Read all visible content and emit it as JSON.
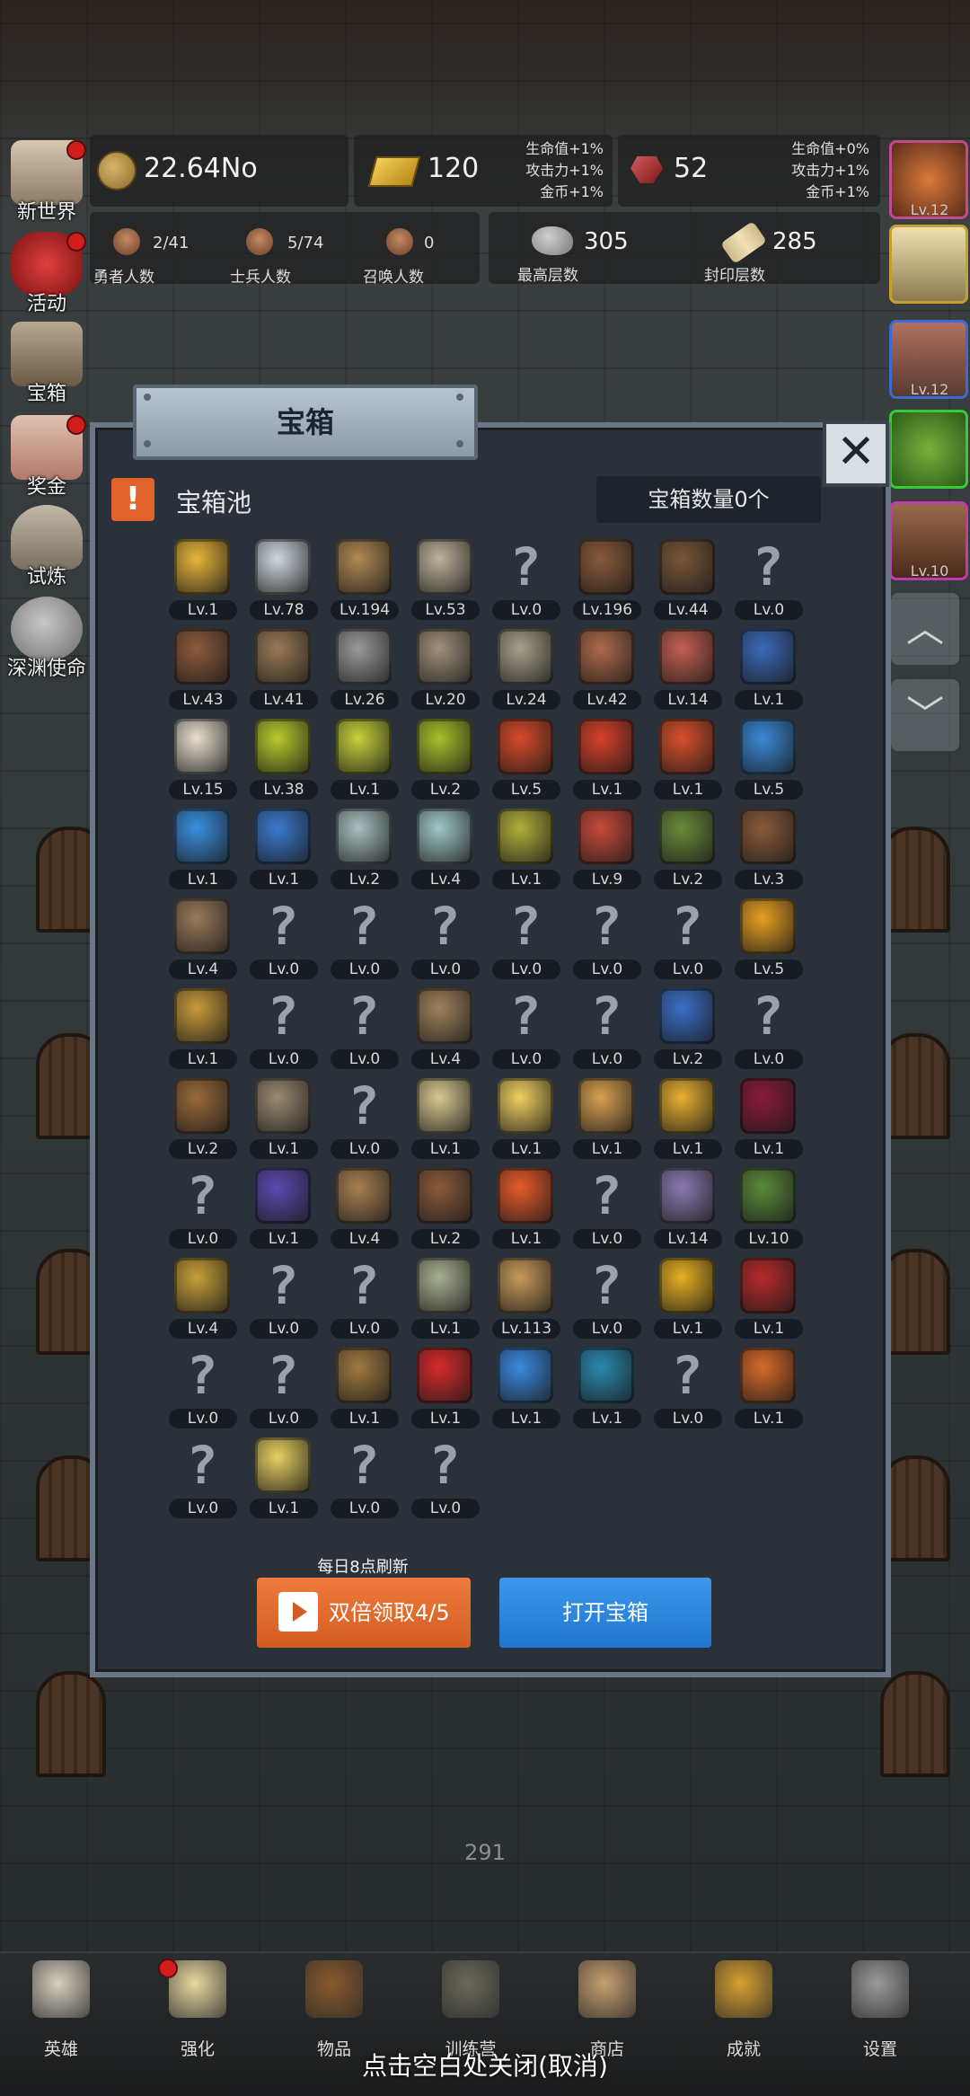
{
  "top": {
    "gold": {
      "value": "22.64No",
      "icon": "gold-coin-icon"
    },
    "bar": {
      "value": "120",
      "bonuses": [
        "生命值+1%",
        "攻击力+1%",
        "金币+1%"
      ],
      "icon": "gold-bar-icon"
    },
    "gem": {
      "value": "52",
      "bonuses": [
        "生命值+0%",
        "攻击力+1%",
        "金币+1%"
      ],
      "icon": "red-gem-icon"
    },
    "counts": [
      {
        "value": "2/41",
        "label": "勇者人数"
      },
      {
        "value": "5/74",
        "label": "士兵人数"
      },
      {
        "value": "0",
        "label": "召唤人数"
      }
    ],
    "floors": [
      {
        "value": "305",
        "label": "最高层数"
      },
      {
        "value": "285",
        "label": "封印层数"
      }
    ]
  },
  "left_menu": [
    {
      "label": "新世界",
      "badge": true
    },
    {
      "label": "活动",
      "badge": true
    },
    {
      "label": "宝箱",
      "badge": false
    },
    {
      "label": "奖金",
      "badge": true
    },
    {
      "label": "试炼",
      "badge": false
    },
    {
      "label": "深渊使命",
      "badge": false
    }
  ],
  "right_menu": {
    "levels": [
      "Lv.12",
      "",
      "Lv.12",
      "",
      "Lv.10"
    ]
  },
  "floor_number": "291",
  "modal": {
    "title": "宝箱",
    "pool_title": "宝箱池",
    "chest_count": "宝箱数量0个",
    "alert_glyph": "!",
    "close_glyph": "✕",
    "refresh_note": "每日8点刷新",
    "double_btn": "双倍领取4/5",
    "open_btn": "打开宝箱",
    "items": [
      {
        "lv": "Lv.1",
        "c": "#e8b63a"
      },
      {
        "lv": "Lv.78",
        "c": "#cfd8e0"
      },
      {
        "lv": "Lv.194",
        "c": "#b08a52"
      },
      {
        "lv": "Lv.53",
        "c": "#bdb199"
      },
      {
        "lv": "Lv.0",
        "c": ""
      },
      {
        "lv": "Lv.196",
        "c": "#8a5a3a"
      },
      {
        "lv": "Lv.44",
        "c": "#7a5638"
      },
      {
        "lv": "Lv.0",
        "c": ""
      },
      {
        "lv": "Lv.43",
        "c": "#8e5a3a"
      },
      {
        "lv": "Lv.41",
        "c": "#9a7a55"
      },
      {
        "lv": "Lv.26",
        "c": "#9a9a9a"
      },
      {
        "lv": "Lv.20",
        "c": "#a0917a"
      },
      {
        "lv": "Lv.24",
        "c": "#a8a08a"
      },
      {
        "lv": "Lv.42",
        "c": "#b06a4a"
      },
      {
        "lv": "Lv.14",
        "c": "#c56050"
      },
      {
        "lv": "Lv.1",
        "c": "#3a6aba"
      },
      {
        "lv": "Lv.15",
        "c": "#e8dfcf"
      },
      {
        "lv": "Lv.38",
        "c": "#b8cb2a"
      },
      {
        "lv": "Lv.1",
        "c": "#c6d23a"
      },
      {
        "lv": "Lv.2",
        "c": "#a8c02a"
      },
      {
        "lv": "Lv.5",
        "c": "#d84a2a"
      },
      {
        "lv": "Lv.1",
        "c": "#d8402a"
      },
      {
        "lv": "Lv.1",
        "c": "#d8502a"
      },
      {
        "lv": "Lv.5",
        "c": "#3a8ad8"
      },
      {
        "lv": "Lv.1",
        "c": "#3a90e0"
      },
      {
        "lv": "Lv.1",
        "c": "#3a7ad0"
      },
      {
        "lv": "Lv.2",
        "c": "#a8c0c0"
      },
      {
        "lv": "Lv.4",
        "c": "#a0c8c8"
      },
      {
        "lv": "Lv.1",
        "c": "#b0b03a"
      },
      {
        "lv": "Lv.9",
        "c": "#c84a3a"
      },
      {
        "lv": "Lv.2",
        "c": "#6a8a3a"
      },
      {
        "lv": "Lv.3",
        "c": "#8a5a3a"
      },
      {
        "lv": "Lv.4",
        "c": "#9a7a5a"
      },
      {
        "lv": "Lv.0",
        "c": ""
      },
      {
        "lv": "Lv.0",
        "c": ""
      },
      {
        "lv": "Lv.0",
        "c": ""
      },
      {
        "lv": "Lv.0",
        "c": ""
      },
      {
        "lv": "Lv.0",
        "c": ""
      },
      {
        "lv": "Lv.0",
        "c": ""
      },
      {
        "lv": "Lv.5",
        "c": "#e8a020"
      },
      {
        "lv": "Lv.1",
        "c": "#c89a3a"
      },
      {
        "lv": "Lv.0",
        "c": ""
      },
      {
        "lv": "Lv.0",
        "c": ""
      },
      {
        "lv": "Lv.4",
        "c": "#a0825a"
      },
      {
        "lv": "Lv.0",
        "c": ""
      },
      {
        "lv": "Lv.0",
        "c": ""
      },
      {
        "lv": "Lv.2",
        "c": "#3a70c8"
      },
      {
        "lv": "Lv.0",
        "c": ""
      },
      {
        "lv": "Lv.2",
        "c": "#9a6a3a"
      },
      {
        "lv": "Lv.1",
        "c": "#9a8a70"
      },
      {
        "lv": "Lv.0",
        "c": ""
      },
      {
        "lv": "Lv.1",
        "c": "#d8c890"
      },
      {
        "lv": "Lv.1",
        "c": "#f0d060"
      },
      {
        "lv": "Lv.1",
        "c": "#d8a050"
      },
      {
        "lv": "Lv.1",
        "c": "#e8b030"
      },
      {
        "lv": "Lv.1",
        "c": "#8a1a3a"
      },
      {
        "lv": "Lv.0",
        "c": ""
      },
      {
        "lv": "Lv.1",
        "c": "#5a4ab0"
      },
      {
        "lv": "Lv.4",
        "c": "#a88050"
      },
      {
        "lv": "Lv.2",
        "c": "#8a5a3a"
      },
      {
        "lv": "Lv.1",
        "c": "#e85a2a"
      },
      {
        "lv": "Lv.0",
        "c": ""
      },
      {
        "lv": "Lv.14",
        "c": "#8a7ab0"
      },
      {
        "lv": "Lv.10",
        "c": "#5a8a3a"
      },
      {
        "lv": "Lv.4",
        "c": "#c8a03a"
      },
      {
        "lv": "Lv.0",
        "c": ""
      },
      {
        "lv": "Lv.0",
        "c": ""
      },
      {
        "lv": "Lv.1",
        "c": "#a8b090"
      },
      {
        "lv": "Lv.113",
        "c": "#c89a5a"
      },
      {
        "lv": "Lv.0",
        "c": ""
      },
      {
        "lv": "Lv.1",
        "c": "#e8b020"
      },
      {
        "lv": "Lv.1",
        "c": "#b82a2a"
      },
      {
        "lv": "Lv.0",
        "c": ""
      },
      {
        "lv": "Lv.0",
        "c": ""
      },
      {
        "lv": "Lv.1",
        "c": "#a07a40"
      },
      {
        "lv": "Lv.1",
        "c": "#d82a2a"
      },
      {
        "lv": "Lv.1",
        "c": "#3a8ae0"
      },
      {
        "lv": "Lv.1",
        "c": "#2a8ab0"
      },
      {
        "lv": "Lv.0",
        "c": ""
      },
      {
        "lv": "Lv.1",
        "c": "#d86a2a"
      },
      {
        "lv": "Lv.0",
        "c": ""
      },
      {
        "lv": "Lv.1",
        "c": "#e8d060"
      },
      {
        "lv": "Lv.0",
        "c": ""
      },
      {
        "lv": "Lv.0",
        "c": ""
      }
    ]
  },
  "nav": [
    {
      "label": "英雄",
      "icon": "skull-icon",
      "badge": false
    },
    {
      "label": "强化",
      "icon": "candle-icon",
      "badge": true
    },
    {
      "label": "物品",
      "icon": "book-icon",
      "badge": false
    },
    {
      "label": "训练营",
      "icon": "lantern-icon",
      "badge": false
    },
    {
      "label": "商店",
      "icon": "mug-icon",
      "badge": false
    },
    {
      "label": "成就",
      "icon": "key-icon",
      "badge": false
    },
    {
      "label": "设置",
      "icon": "gear-icon",
      "badge": false
    }
  ],
  "close_hint": "点击空白处关闭(取消)",
  "colors": {
    "accent_orange": "#e06a2e",
    "accent_blue": "#2d86de",
    "panel": "#2a313b"
  }
}
